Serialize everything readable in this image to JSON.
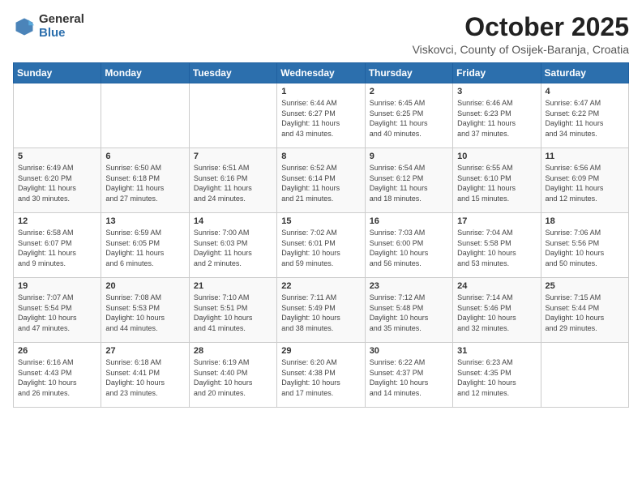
{
  "header": {
    "logo_general": "General",
    "logo_blue": "Blue",
    "month": "October 2025",
    "location": "Viskovci, County of Osijek-Baranja, Croatia"
  },
  "days_of_week": [
    "Sunday",
    "Monday",
    "Tuesday",
    "Wednesday",
    "Thursday",
    "Friday",
    "Saturday"
  ],
  "weeks": [
    [
      {
        "day": "",
        "info": ""
      },
      {
        "day": "",
        "info": ""
      },
      {
        "day": "",
        "info": ""
      },
      {
        "day": "1",
        "info": "Sunrise: 6:44 AM\nSunset: 6:27 PM\nDaylight: 11 hours\nand 43 minutes."
      },
      {
        "day": "2",
        "info": "Sunrise: 6:45 AM\nSunset: 6:25 PM\nDaylight: 11 hours\nand 40 minutes."
      },
      {
        "day": "3",
        "info": "Sunrise: 6:46 AM\nSunset: 6:23 PM\nDaylight: 11 hours\nand 37 minutes."
      },
      {
        "day": "4",
        "info": "Sunrise: 6:47 AM\nSunset: 6:22 PM\nDaylight: 11 hours\nand 34 minutes."
      }
    ],
    [
      {
        "day": "5",
        "info": "Sunrise: 6:49 AM\nSunset: 6:20 PM\nDaylight: 11 hours\nand 30 minutes."
      },
      {
        "day": "6",
        "info": "Sunrise: 6:50 AM\nSunset: 6:18 PM\nDaylight: 11 hours\nand 27 minutes."
      },
      {
        "day": "7",
        "info": "Sunrise: 6:51 AM\nSunset: 6:16 PM\nDaylight: 11 hours\nand 24 minutes."
      },
      {
        "day": "8",
        "info": "Sunrise: 6:52 AM\nSunset: 6:14 PM\nDaylight: 11 hours\nand 21 minutes."
      },
      {
        "day": "9",
        "info": "Sunrise: 6:54 AM\nSunset: 6:12 PM\nDaylight: 11 hours\nand 18 minutes."
      },
      {
        "day": "10",
        "info": "Sunrise: 6:55 AM\nSunset: 6:10 PM\nDaylight: 11 hours\nand 15 minutes."
      },
      {
        "day": "11",
        "info": "Sunrise: 6:56 AM\nSunset: 6:09 PM\nDaylight: 11 hours\nand 12 minutes."
      }
    ],
    [
      {
        "day": "12",
        "info": "Sunrise: 6:58 AM\nSunset: 6:07 PM\nDaylight: 11 hours\nand 9 minutes."
      },
      {
        "day": "13",
        "info": "Sunrise: 6:59 AM\nSunset: 6:05 PM\nDaylight: 11 hours\nand 6 minutes."
      },
      {
        "day": "14",
        "info": "Sunrise: 7:00 AM\nSunset: 6:03 PM\nDaylight: 11 hours\nand 2 minutes."
      },
      {
        "day": "15",
        "info": "Sunrise: 7:02 AM\nSunset: 6:01 PM\nDaylight: 10 hours\nand 59 minutes."
      },
      {
        "day": "16",
        "info": "Sunrise: 7:03 AM\nSunset: 6:00 PM\nDaylight: 10 hours\nand 56 minutes."
      },
      {
        "day": "17",
        "info": "Sunrise: 7:04 AM\nSunset: 5:58 PM\nDaylight: 10 hours\nand 53 minutes."
      },
      {
        "day": "18",
        "info": "Sunrise: 7:06 AM\nSunset: 5:56 PM\nDaylight: 10 hours\nand 50 minutes."
      }
    ],
    [
      {
        "day": "19",
        "info": "Sunrise: 7:07 AM\nSunset: 5:54 PM\nDaylight: 10 hours\nand 47 minutes."
      },
      {
        "day": "20",
        "info": "Sunrise: 7:08 AM\nSunset: 5:53 PM\nDaylight: 10 hours\nand 44 minutes."
      },
      {
        "day": "21",
        "info": "Sunrise: 7:10 AM\nSunset: 5:51 PM\nDaylight: 10 hours\nand 41 minutes."
      },
      {
        "day": "22",
        "info": "Sunrise: 7:11 AM\nSunset: 5:49 PM\nDaylight: 10 hours\nand 38 minutes."
      },
      {
        "day": "23",
        "info": "Sunrise: 7:12 AM\nSunset: 5:48 PM\nDaylight: 10 hours\nand 35 minutes."
      },
      {
        "day": "24",
        "info": "Sunrise: 7:14 AM\nSunset: 5:46 PM\nDaylight: 10 hours\nand 32 minutes."
      },
      {
        "day": "25",
        "info": "Sunrise: 7:15 AM\nSunset: 5:44 PM\nDaylight: 10 hours\nand 29 minutes."
      }
    ],
    [
      {
        "day": "26",
        "info": "Sunrise: 6:16 AM\nSunset: 4:43 PM\nDaylight: 10 hours\nand 26 minutes."
      },
      {
        "day": "27",
        "info": "Sunrise: 6:18 AM\nSunset: 4:41 PM\nDaylight: 10 hours\nand 23 minutes."
      },
      {
        "day": "28",
        "info": "Sunrise: 6:19 AM\nSunset: 4:40 PM\nDaylight: 10 hours\nand 20 minutes."
      },
      {
        "day": "29",
        "info": "Sunrise: 6:20 AM\nSunset: 4:38 PM\nDaylight: 10 hours\nand 17 minutes."
      },
      {
        "day": "30",
        "info": "Sunrise: 6:22 AM\nSunset: 4:37 PM\nDaylight: 10 hours\nand 14 minutes."
      },
      {
        "day": "31",
        "info": "Sunrise: 6:23 AM\nSunset: 4:35 PM\nDaylight: 10 hours\nand 12 minutes."
      },
      {
        "day": "",
        "info": ""
      }
    ]
  ]
}
